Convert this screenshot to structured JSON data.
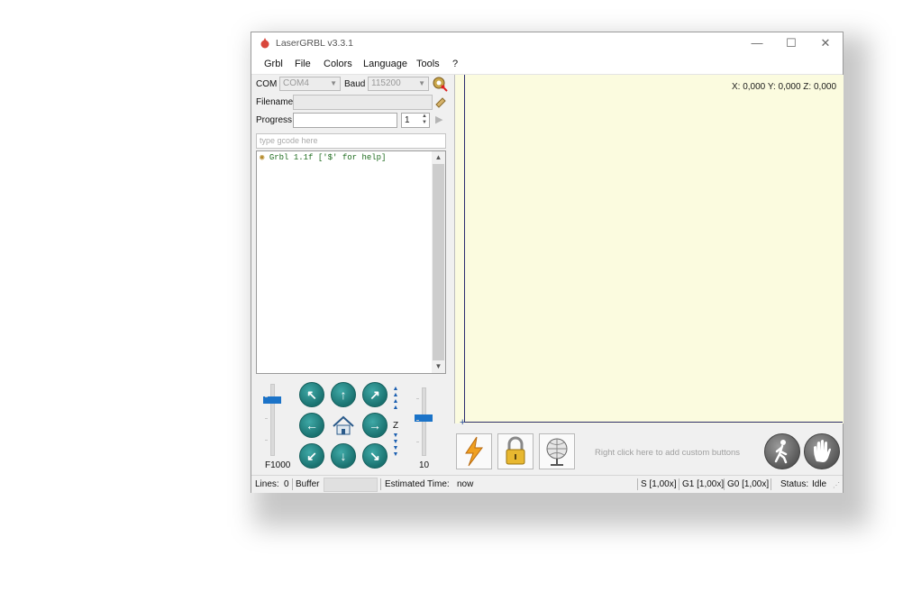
{
  "window": {
    "title": "LaserGRBL v3.3.1",
    "minimize": "—",
    "maximize": "☐",
    "close": "✕"
  },
  "menu": [
    "Grbl",
    "File",
    "Colors",
    "Language",
    "Tools",
    "?"
  ],
  "connection": {
    "com_label": "COM",
    "com_value": "COM4",
    "baud_label": "Baud",
    "baud_value": "115200",
    "filename_label": "Filename",
    "progress_label": "Progress",
    "copies_value": "1"
  },
  "gcode_input": {
    "placeholder": "type gcode here"
  },
  "console": {
    "lines": [
      "Grbl 1.1f ['$' for help]"
    ]
  },
  "jog": {
    "speed_label": "F1000",
    "step_label": "10",
    "z_label": "Z",
    "speed_level": 0.8,
    "step_level": 0.55
  },
  "canvas": {
    "coordinates": "X: 0,000 Y: 0,000 Z: 0,000"
  },
  "toolbar": {
    "custom_hint": "Right click here to add custom buttons"
  },
  "statusbar": {
    "lines_label": "Lines:",
    "lines_value": "0",
    "buffer_label": "Buffer",
    "estimated_label": "Estimated Time:",
    "estimated_value": "now",
    "s_override": "S [1,00x]",
    "g1_override": "G1 [1,00x]",
    "g0_override": "G0 [1,00x]",
    "status_label": "Status:",
    "status_value": "Idle"
  },
  "colors": {
    "jog_button": "#1a7270",
    "canvas_bg": "#fbfbdf",
    "slider": "#1b73c8",
    "console_text": "#1d6b1d"
  }
}
